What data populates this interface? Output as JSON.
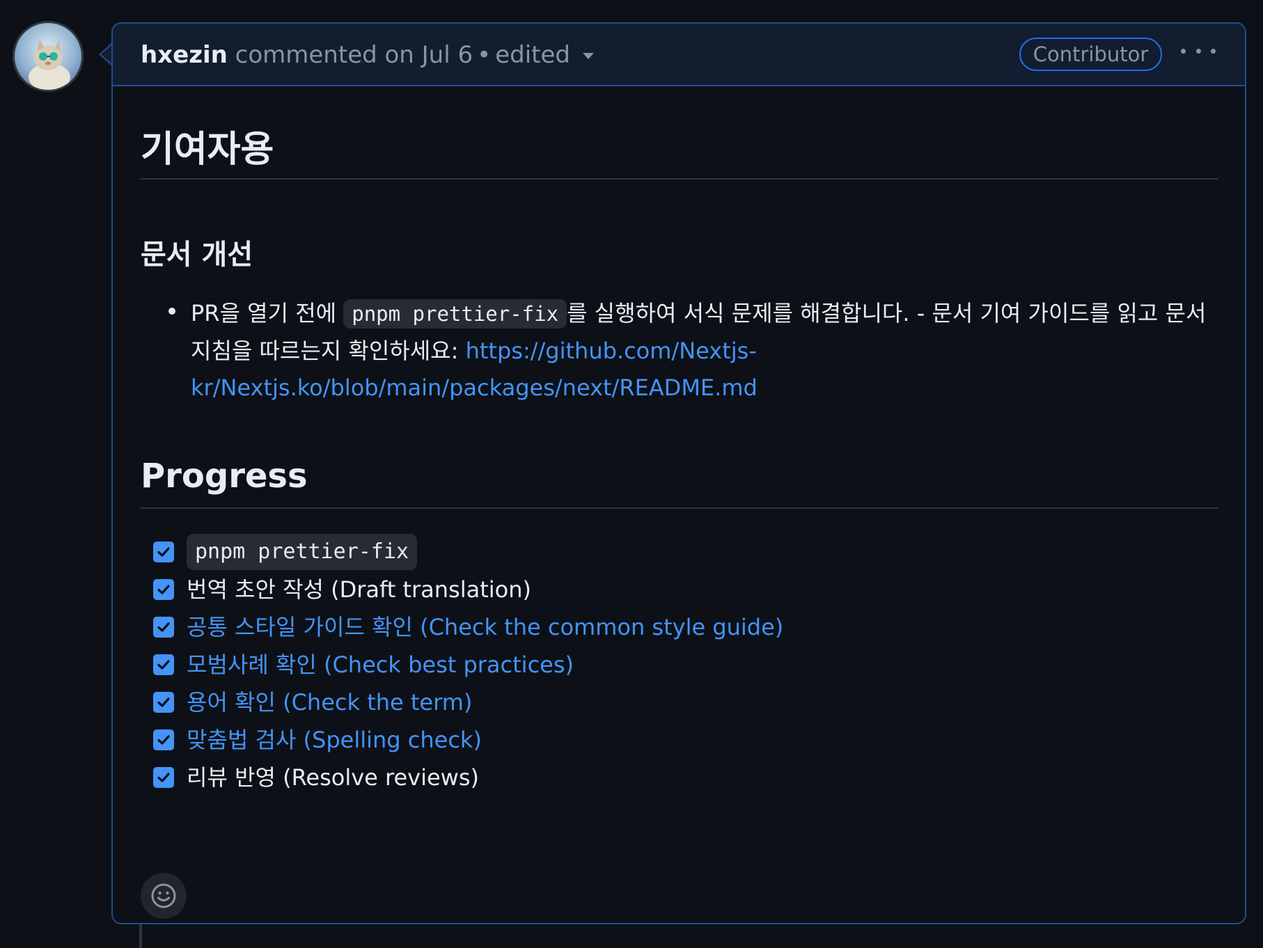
{
  "comment": {
    "author": "hxezin",
    "action": "commented on Jul 6",
    "separator": "•",
    "edited_label": "edited",
    "role_badge": "Contributor",
    "menu_icon": "kebab-horizontal-icon"
  },
  "body": {
    "title": "기여자용",
    "section_heading": "문서 개선",
    "bullet": {
      "text_before": "PR을 열기 전에 ",
      "code": "pnpm prettier-fix",
      "text_after": "를 실행하여 서식 문제를 해결합니다. - 문서 기여 가이드를 읽고 문서 지침을 따르는지 확인하세요: ",
      "link": "https://github.com/Nextjs-kr/Nextjs.ko/blob/main/packages/next/README.md"
    },
    "progress_heading": "Progress",
    "tasks": [
      {
        "label": "pnpm prettier-fix",
        "checked": true,
        "style": "code"
      },
      {
        "label": "번역 초안 작성 (Draft translation)",
        "checked": true,
        "style": "plain"
      },
      {
        "label": "공통 스타일 가이드 확인 (Check the common style guide)",
        "checked": true,
        "style": "link"
      },
      {
        "label": "모범사례 확인 (Check best practices)",
        "checked": true,
        "style": "link"
      },
      {
        "label": "용어 확인 (Check the term)",
        "checked": true,
        "style": "link"
      },
      {
        "label": "맞춤법 검사 (Spelling check)",
        "checked": true,
        "style": "link"
      },
      {
        "label": "리뷰 반영 (Resolve reviews)",
        "checked": true,
        "style": "plain"
      }
    ],
    "reaction_icon": "smiley-icon"
  },
  "colors": {
    "background": "#0d1117",
    "header_bg": "#121d2f",
    "border_accent": "#1f4d8f",
    "link": "#4493f8",
    "checkbox": "#4493f8",
    "muted": "#8b949e"
  }
}
